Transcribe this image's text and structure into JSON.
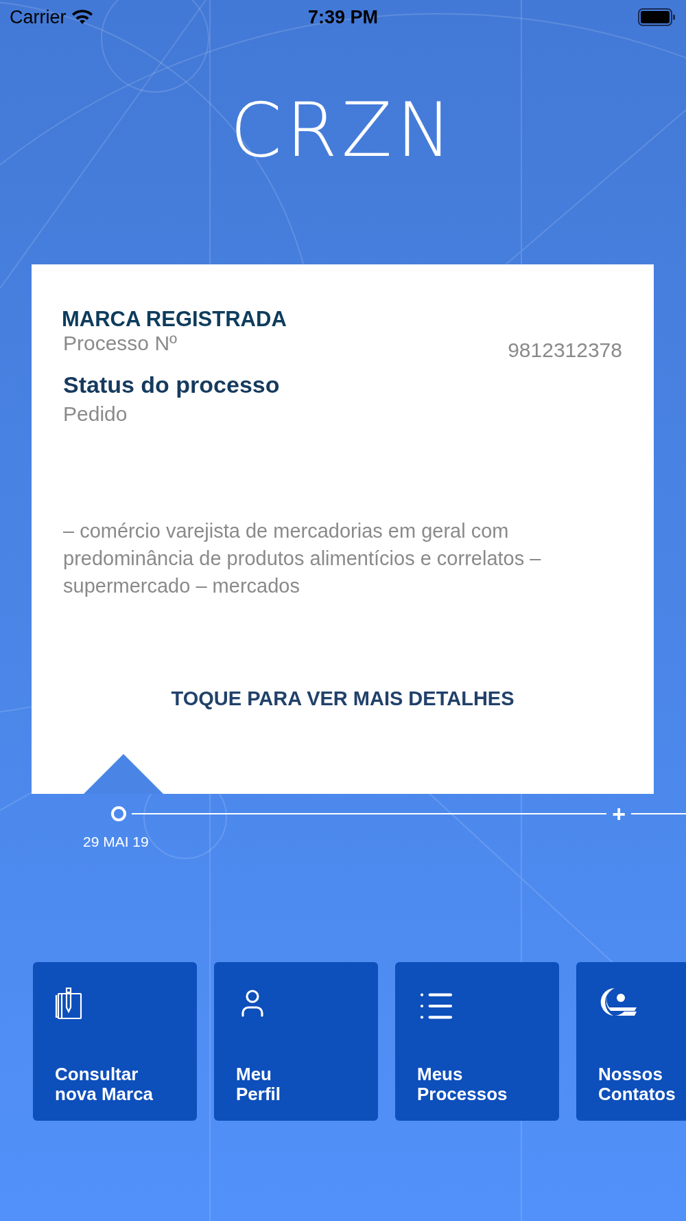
{
  "status_bar": {
    "carrier": "Carrier",
    "time": "7:39 PM"
  },
  "logo": {
    "text": "CRZN"
  },
  "card": {
    "category": "MARCA REGISTRADA",
    "process_label": "Processo Nº",
    "process_number": "9812312378",
    "status_title": "Status do processo",
    "status_value": "Pedido",
    "description": "– comércio varejista de mercadorias em geral com predominância de produtos alimentícios e correlatos – supermercado – mercados",
    "action": "TOQUE PARA VER MAIS DETALHES"
  },
  "timeline": {
    "events": [
      {
        "date": "29 MAI 19",
        "selected": true
      }
    ],
    "more": "+"
  },
  "tiles": [
    {
      "kind": "notebook",
      "line1": "Consultar",
      "line2": "nova Marca"
    },
    {
      "kind": "user",
      "line1": "Meu",
      "line2": "Perfil"
    },
    {
      "kind": "list",
      "line1": "Meus",
      "line2": "Processos"
    },
    {
      "kind": "contact",
      "line1": "Nossos",
      "line2": "Contatos"
    }
  ]
}
